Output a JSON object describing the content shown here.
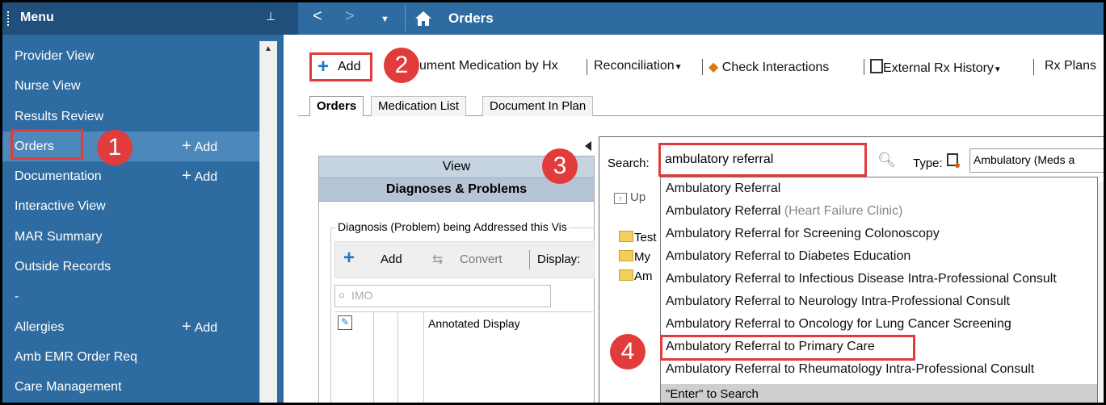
{
  "menu": {
    "title": "Menu",
    "pin_icon": "pin-icon",
    "items": [
      {
        "label": "Provider View"
      },
      {
        "label": "Nurse View"
      },
      {
        "label": "Results Review"
      },
      {
        "label": "Orders",
        "add": "Add"
      },
      {
        "label": "Documentation",
        "add": "Add"
      },
      {
        "label": "Interactive View"
      },
      {
        "label": "MAR Summary"
      },
      {
        "label": "Outside Records"
      },
      {
        "label": "-"
      },
      {
        "label": "Allergies",
        "add": "Add"
      },
      {
        "label": "Amb EMR Order Req"
      },
      {
        "label": "Care Management"
      }
    ]
  },
  "topbar": {
    "title": "Orders",
    "back": "<",
    "forward": ">",
    "dropdown": "▼"
  },
  "toolbar": {
    "add": "Add",
    "document_med": "ument Medication by Hx",
    "reconciliation": "Reconciliation",
    "check_interactions": "Check Interactions",
    "external_rx": "External Rx History",
    "rx_plans": "Rx Plans"
  },
  "tabs": [
    "Orders",
    "Medication List",
    "Document In Plan"
  ],
  "left_panel": {
    "view": "View",
    "diagnoses": "Diagnoses & Problems",
    "group_label": "Diagnosis (Problem) being Addressed this Vis",
    "add": "Add",
    "convert": "Convert",
    "display": "Display:",
    "imo_placeholder": "IMO",
    "column": "Annotated Display"
  },
  "search": {
    "label": "Search:",
    "value": "ambulatory referral",
    "type_label": "Type:",
    "type_value": "Ambulatory (Meds a",
    "up": "Up",
    "folders": [
      "Test",
      "My",
      "Am"
    ]
  },
  "dropdown": {
    "items": [
      {
        "text": "Ambulatory Referral",
        "sub": ""
      },
      {
        "text": "Ambulatory Referral",
        "sub": "(Heart Failure Clinic)"
      },
      {
        "text": "Ambulatory Referral for Screening Colonoscopy",
        "sub": ""
      },
      {
        "text": "Ambulatory Referral to Diabetes Education",
        "sub": ""
      },
      {
        "text": "Ambulatory Referral to Infectious Disease Intra-Professional Consult",
        "sub": ""
      },
      {
        "text": "Ambulatory Referral to Neurology Intra-Professional Consult",
        "sub": ""
      },
      {
        "text": "Ambulatory Referral to Oncology for Lung Cancer Screening",
        "sub": ""
      },
      {
        "text": "Ambulatory Referral to Primary Care",
        "sub": ""
      },
      {
        "text": "Ambulatory Referral to Rheumatology Intra-Professional Consult",
        "sub": ""
      }
    ],
    "enter_hint": "\"Enter\" to Search"
  },
  "badges": [
    "1",
    "2",
    "3",
    "4"
  ],
  "colors": {
    "nav_bg": "#2e6ba0",
    "header_bg": "#1f4f7a",
    "highlight": "#e23b3b",
    "plus_blue": "#1e78c8"
  }
}
